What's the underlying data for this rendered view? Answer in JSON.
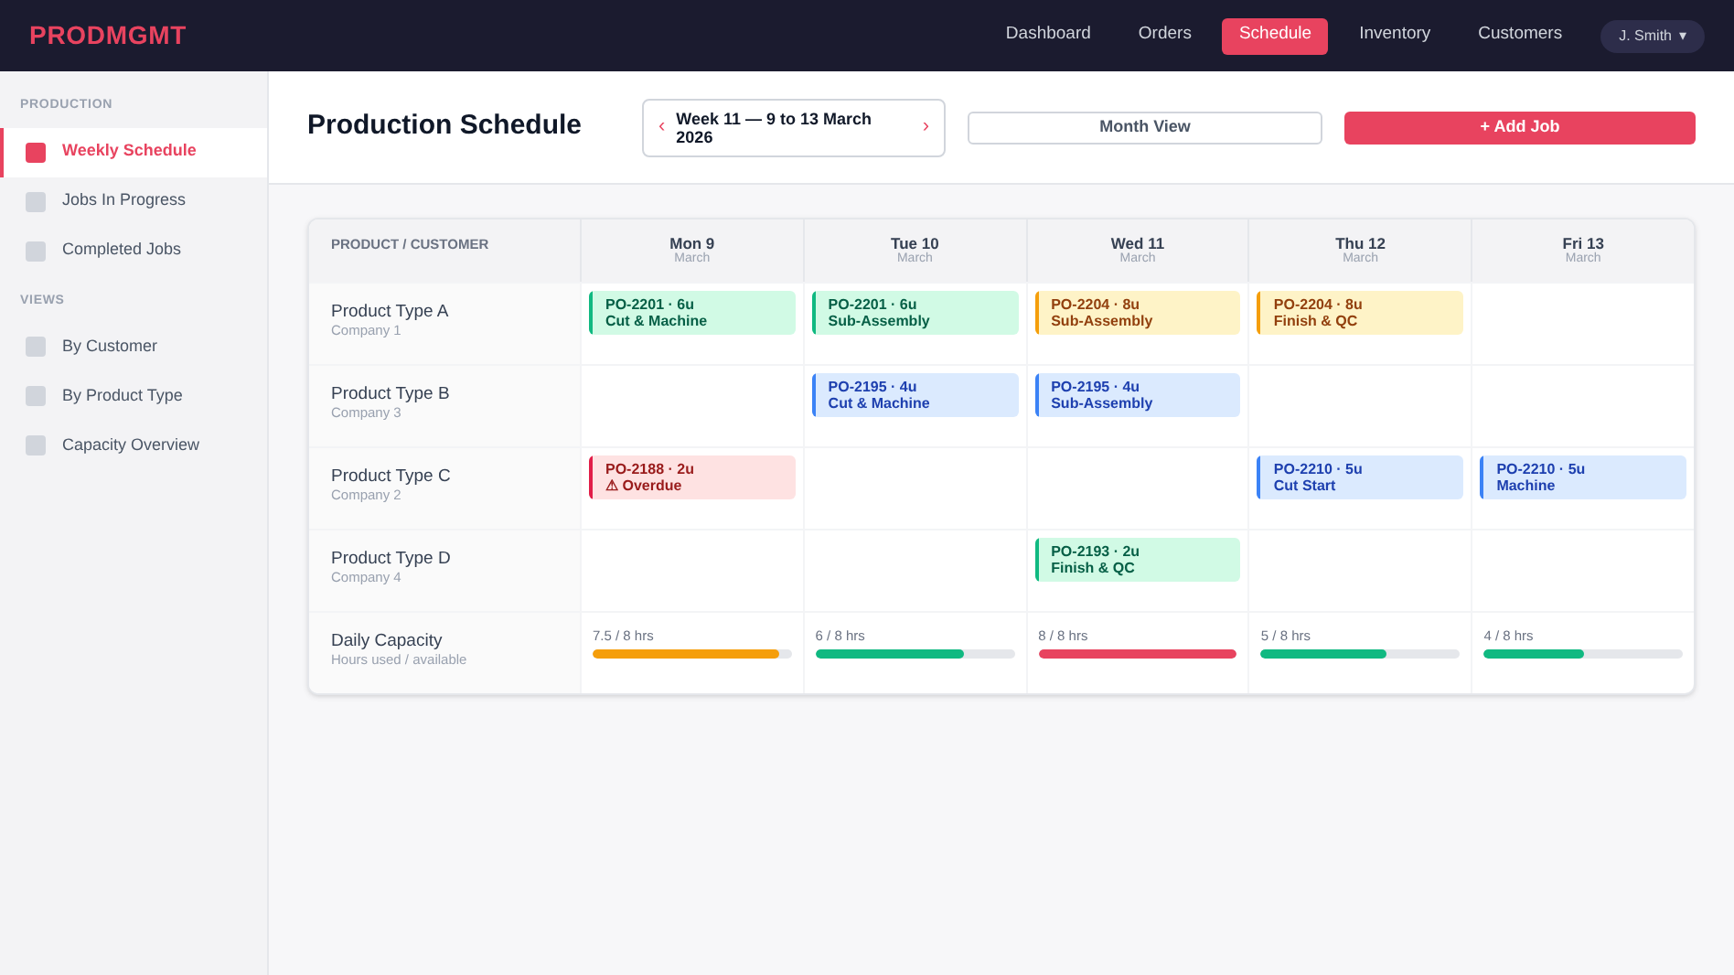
{
  "app": {
    "logo": "PRODMGMT"
  },
  "nav": [
    {
      "label": "Dashboard",
      "selected": false
    },
    {
      "label": "Orders",
      "selected": false
    },
    {
      "label": "Schedule",
      "selected": true
    },
    {
      "label": "Inventory",
      "selected": false
    },
    {
      "label": "Customers",
      "selected": false
    }
  ],
  "user_menu": {
    "label": "J. Smith",
    "caret": "▾"
  },
  "sidebar": {
    "sections": [
      {
        "title": "PRODUCTION",
        "items": [
          {
            "label": "Weekly Schedule",
            "selected": true
          },
          {
            "label": "Jobs In Progress",
            "selected": false
          },
          {
            "label": "Completed Jobs",
            "selected": false
          }
        ]
      },
      {
        "title": "VIEWS",
        "items": [
          {
            "label": "By Customer",
            "selected": false
          },
          {
            "label": "By Product Type",
            "selected": false
          },
          {
            "label": "Capacity Overview",
            "selected": false
          }
        ]
      }
    ]
  },
  "header": {
    "title": "Production Schedule",
    "week_picker": {
      "prev": "‹",
      "label": "Week 11 — 9 to 13 March 2026",
      "next": "›"
    },
    "buttons": [
      {
        "label": "Month View",
        "kind": "outline"
      },
      {
        "label": "+ Add Job",
        "kind": "primary"
      }
    ]
  },
  "table": {
    "corner": "PRODUCT / CUSTOMER",
    "days": [
      {
        "day": "Mon 9",
        "month": "March"
      },
      {
        "day": "Tue 10",
        "month": "March"
      },
      {
        "day": "Wed 11",
        "month": "March"
      },
      {
        "day": "Thu 12",
        "month": "March"
      },
      {
        "day": "Fri 13",
        "month": "March"
      }
    ],
    "rows": [
      {
        "product": "Product Type A",
        "customer": "Company 1",
        "cells": [
          {
            "line1": "PO-2201 · 6u",
            "line2": "Cut & Machine",
            "color": "#10b981"
          },
          {
            "line1": "PO-2201 · 6u",
            "line2": "Sub-Assembly",
            "color": "#10b981"
          },
          {
            "line1": "PO-2204 · 8u",
            "line2": "Sub-Assembly",
            "color": "#f59e0b"
          },
          {
            "line1": "PO-2204 · 8u",
            "line2": "Finish & QC",
            "color": "#f59e0b"
          },
          null
        ]
      },
      {
        "product": "Product Type B",
        "customer": "Company 3",
        "cells": [
          null,
          {
            "line1": "PO-2195 · 4u",
            "line2": "Cut & Machine",
            "color": "#3b82f6"
          },
          {
            "line1": "PO-2195 · 4u",
            "line2": "Sub-Assembly",
            "color": "#3b82f6"
          },
          null,
          null
        ]
      },
      {
        "product": "Product Type C",
        "customer": "Company 2",
        "cells": [
          {
            "line1": "PO-2188 · 2u",
            "line2": "⚠ Overdue",
            "color": "#e11d48"
          },
          null,
          null,
          {
            "line1": "PO-2210 · 5u",
            "line2": "Cut Start",
            "color": "#3b82f6"
          },
          {
            "line1": "PO-2210 · 5u",
            "line2": "Machine",
            "color": "#3b82f6"
          }
        ]
      },
      {
        "product": "Product Type D",
        "customer": "Company 4",
        "cells": [
          null,
          null,
          {
            "line1": "PO-2193 · 2u",
            "line2": "Finish & QC",
            "color": "#10b981"
          },
          null,
          null
        ]
      }
    ],
    "capacity": {
      "title": "Daily Capacity",
      "subtitle": "Hours used / available",
      "days": [
        {
          "reading": "7.5 / 8 hrs",
          "level": 0.94,
          "color": "#f59e0b"
        },
        {
          "reading": "6 / 8 hrs",
          "level": 0.75,
          "color": "#10b981"
        },
        {
          "reading": "8 / 8 hrs",
          "level": 1,
          "color": "#e8435f"
        },
        {
          "reading": "5 / 8 hrs",
          "level": 0.63,
          "color": "#10b981"
        },
        {
          "reading": "4 / 8 hrs",
          "level": 0.5,
          "color": "#10b981"
        }
      ]
    }
  }
}
